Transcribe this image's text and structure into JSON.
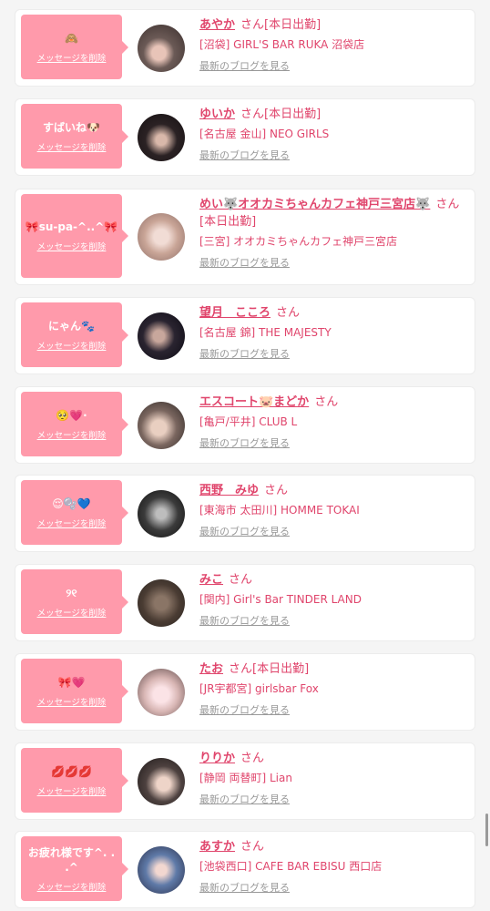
{
  "delete_label": "メッセージを削除",
  "blog_label": "最新のブログを見る",
  "san_label": "さん",
  "colors": {
    "accent": "#ff9aab",
    "text_pink": "#e0456c",
    "muted": "#999999"
  },
  "items": [
    {
      "message": "🙈",
      "name": "あやか",
      "working": "[本日出勤]",
      "shop": "[沼袋] GIRL'S BAR RUKA 沼袋店"
    },
    {
      "message": "すばいね🐶",
      "name": "ゆいか",
      "working": "[本日出勤]",
      "shop": "[名古屋 金山] NEO GIRLS"
    },
    {
      "message": "🎀su-pa-^..^🎀",
      "name": "めい🐺オオカミちゃんカフェ神戸三宮店🐺",
      "working": "[本日出勤]",
      "shop": "[三宮] オオカミちゃんカフェ神戸三宮店"
    },
    {
      "message": "にゃん🐾",
      "name": "望月　こころ",
      "working": "",
      "shop": "[名古屋 錦] THE MAJESTY"
    },
    {
      "message": "🥺💗·",
      "name": "エスコート🐷まどか",
      "working": "",
      "shop": "[亀戸/平井] CLUB L"
    },
    {
      "message": "😌🫧💙",
      "name": "西野　みゆ",
      "working": "",
      "shop": "[東海市 太田川] HOMME TOKAI"
    },
    {
      "message": "୨୧",
      "name": "みこ",
      "working": "",
      "shop": "[関内] Girl's Bar TINDER LAND"
    },
    {
      "message": "🎀💗",
      "name": "たお",
      "working": "[本日出勤]",
      "shop": "[JR宇都宮] girlsbar Fox"
    },
    {
      "message": "💋💋💋",
      "name": "りりか",
      "working": "",
      "shop": "[静岡 両替町] Lian"
    },
    {
      "message": "お疲れ様です^. . .^",
      "name": "あすか",
      "working": "",
      "shop": "[池袋西口] CAFE BAR EBISU 西口店"
    }
  ]
}
